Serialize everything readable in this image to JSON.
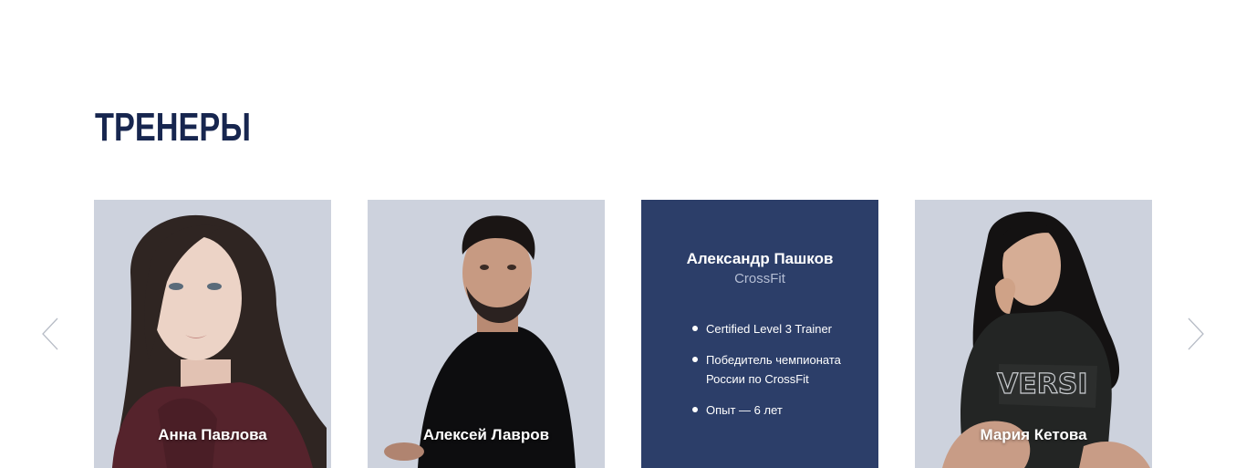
{
  "section": {
    "title": "ТРЕНЕРЫ"
  },
  "carousel": {
    "prev_icon": "chevron-left-icon",
    "next_icon": "chevron-right-icon",
    "trainers": [
      {
        "name": "Анна Павлова"
      },
      {
        "name": "Алексей Лавров"
      },
      {
        "name": "Александр Пашков",
        "sport": "CrossFit",
        "achievements": [
          "Certified Level 3 Trainer",
          "Победитель чемпионата России по CrossFit",
          "Опыт — 6 лет"
        ]
      },
      {
        "name": "Мария Кетова"
      }
    ]
  },
  "colors": {
    "title": "#17264f",
    "active_card": "#2c3e69",
    "photo_background": "#ccd1dc",
    "arrow": "#b7bcc6"
  }
}
